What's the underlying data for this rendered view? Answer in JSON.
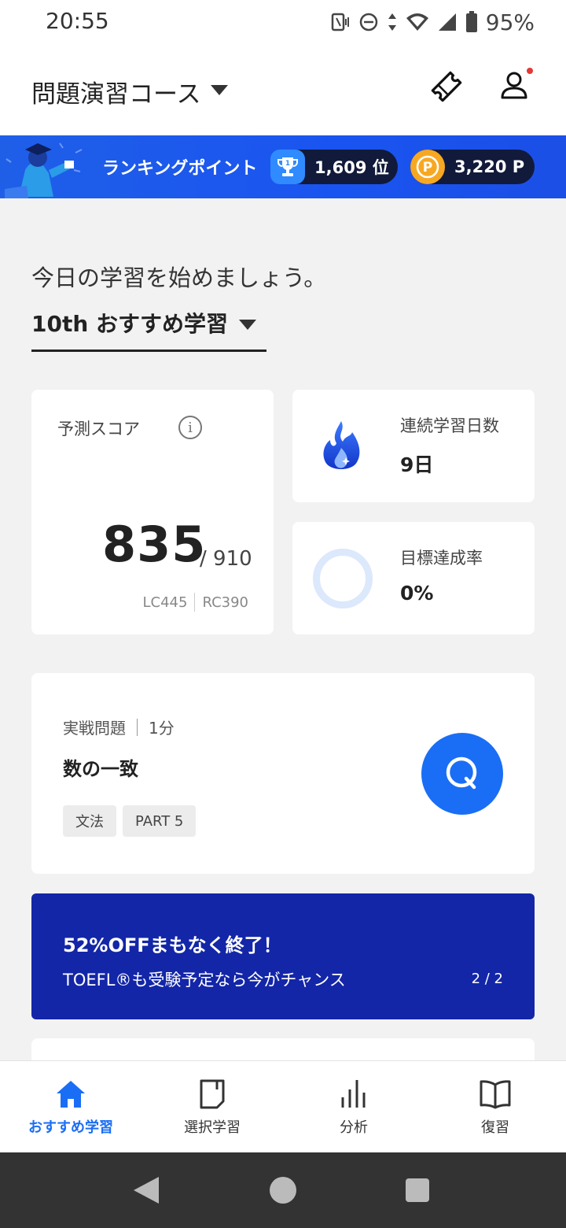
{
  "status_bar": {
    "time": "20:55",
    "battery": "95%"
  },
  "header": {
    "course_title": "問題演習コース"
  },
  "ranking": {
    "label": "ランキングポイント",
    "rank": "1,609 位",
    "points": "3,220 P",
    "points_badge": "P",
    "trophy_digit": "1"
  },
  "main": {
    "greeting": "今日の学習を始めましょう。",
    "recommend_select": "10th おすすめ学習",
    "score": {
      "label": "予測スコア",
      "info_symbol": "i",
      "value": "835",
      "total": "/ 910",
      "lc": "LC445",
      "rc": "RC390"
    },
    "streak": {
      "label": "連続学習日数",
      "value": "9日"
    },
    "goal": {
      "label": "目標達成率",
      "value": "0%",
      "progress": 0
    },
    "practice": {
      "type": "実戦問題",
      "duration": "1分",
      "title": "数の一致",
      "tags": [
        "文法",
        "PART 5"
      ]
    },
    "promo": {
      "title": "52%OFFまもなく終了！",
      "subtitle": "TOEFL®も受験予定なら今がチャンス",
      "page": "2 / 2"
    }
  },
  "bottom_nav": [
    {
      "label": "おすすめ学習",
      "icon": "home-icon",
      "active": true
    },
    {
      "label": "選択学習",
      "icon": "notebook-icon",
      "active": false
    },
    {
      "label": "分析",
      "icon": "bar-chart-icon",
      "active": false
    },
    {
      "label": "復習",
      "icon": "book-icon",
      "active": false
    }
  ],
  "colors": {
    "accent": "#1a6ef5",
    "banner": "#1a54f0",
    "promo": "#1326a8",
    "point_gold": "#f7a823"
  }
}
